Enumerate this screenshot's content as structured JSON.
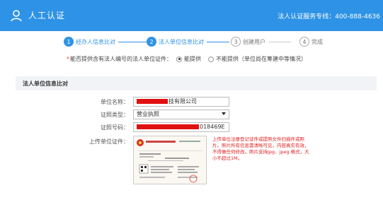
{
  "header": {
    "title": "人工认证",
    "hotline": "法人认证服务专线：400-888-4636",
    "logo_icon": "user-icon",
    "background": "#2e93e6"
  },
  "steps": [
    {
      "number": "1",
      "label": "经办人信息比对",
      "state": "active"
    },
    {
      "number": "2",
      "label": "法人单位信息比对",
      "state": "active"
    },
    {
      "number": "3",
      "label": "创建用户",
      "state": "todo"
    },
    {
      "number": "4",
      "label": "完成",
      "state": "todo"
    }
  ],
  "question": {
    "required_mark": "*",
    "text": "能否提供含有法人编号的法人单位证件：",
    "options": [
      {
        "label": "能提供",
        "checked": true
      },
      {
        "label": "不能提供（单位尚在筹建中等情况）",
        "checked": false
      }
    ]
  },
  "section": {
    "title": "法人单位信息比对"
  },
  "form": {
    "unit_name_label": "单位名称：",
    "unit_name_value": "技有限公司",
    "cert_type_label": "证照类型：",
    "cert_type_value": "营业执照",
    "cert_no_label": "证照号码：",
    "cert_no_value": "018469E",
    "upload_label": "上传单位证件：",
    "upload_note": "上传单位注册登记证件或提照文件扫描件或照片。照片所有信息需清晰可见，内容真实有效，不得做任何修改。照片支持jpg、jpeg 格式，大小不超过1M。"
  },
  "colors": {
    "accent": "#2e93e6",
    "redaction": "#e01010",
    "note": "#e02020"
  }
}
